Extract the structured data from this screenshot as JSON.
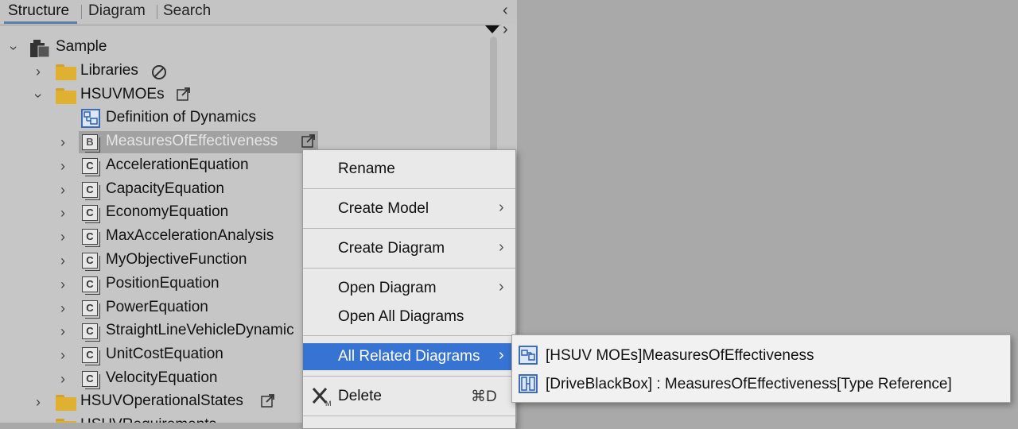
{
  "tabs": {
    "structure": "Structure",
    "diagram": "Diagram",
    "search": "Search"
  },
  "tree": {
    "root": "Sample",
    "libraries": "Libraries",
    "hsuvmoes": "HSUVMOEs",
    "definition_of_dynamics": "Definition of Dynamics",
    "measures": "MeasuresOfEffectiveness",
    "measures_type": "B",
    "class_letter": "C",
    "equations": [
      "AccelerationEquation",
      "CapacityEquation",
      "EconomyEquation",
      "MaxAccelerationAnalysis",
      "MyObjectiveFunction",
      "PositionEquation",
      "PowerEquation",
      "StraightLineVehicleDynamic",
      "UnitCostEquation",
      "VelocityEquation"
    ],
    "operational_states": "HSUVOperationalStates",
    "requirements_partial": "HSUVRequirements"
  },
  "context_menu": {
    "rename": "Rename",
    "create_model": "Create Model",
    "create_diagram": "Create Diagram",
    "open_diagram": "Open Diagram",
    "open_all_diagrams": "Open All Diagrams",
    "all_related_diagrams": "All Related Diagrams",
    "delete": "Delete",
    "delete_shortcut": "⌘D"
  },
  "submenu": {
    "items": [
      "[HSUV MOEs]MeasuresOfEffectiveness",
      "[DriveBlackBox] : MeasuresOfEffectiveness[Type Reference]"
    ]
  },
  "colors": {
    "folder": "#e0b030",
    "highlight": "#3773d2",
    "tab_underline": "#5b7fa8"
  }
}
